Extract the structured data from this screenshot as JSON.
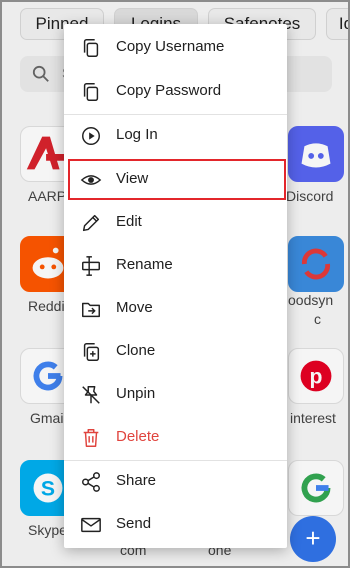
{
  "tabs": [
    "Pinned",
    "Logins",
    "Safenotes",
    "Id"
  ],
  "search": {
    "placeholder": "S"
  },
  "background_labels": {
    "aarp": "AARP",
    "discord": "Discord",
    "reddit": "Reddit",
    "goodsync_line1": "oodsyn",
    "goodsync_line2": "c",
    "gmail": "Gmail",
    "pinterest": "interest",
    "skype": "Skype",
    "com": "com",
    "one": "one"
  },
  "menu": {
    "items": [
      {
        "label": "Copy Username",
        "icon": "copy-icon"
      },
      {
        "label": "Copy Password",
        "icon": "copy-icon"
      },
      {
        "label": "Log In",
        "icon": "play-circle-icon"
      },
      {
        "label": "View",
        "icon": "eye-icon"
      },
      {
        "label": "Edit",
        "icon": "pencil-icon"
      },
      {
        "label": "Rename",
        "icon": "rename-icon"
      },
      {
        "label": "Move",
        "icon": "folder-move-icon"
      },
      {
        "label": "Clone",
        "icon": "clone-icon"
      },
      {
        "label": "Unpin",
        "icon": "unpin-icon"
      },
      {
        "label": "Delete",
        "icon": "trash-icon"
      },
      {
        "label": "Share",
        "icon": "share-icon"
      },
      {
        "label": "Send",
        "icon": "envelope-icon"
      }
    ]
  },
  "fab": {
    "label": "+"
  },
  "colors": {
    "accent": "#2f6fe0",
    "danger": "#e0443e",
    "highlight": "#e3262b"
  }
}
